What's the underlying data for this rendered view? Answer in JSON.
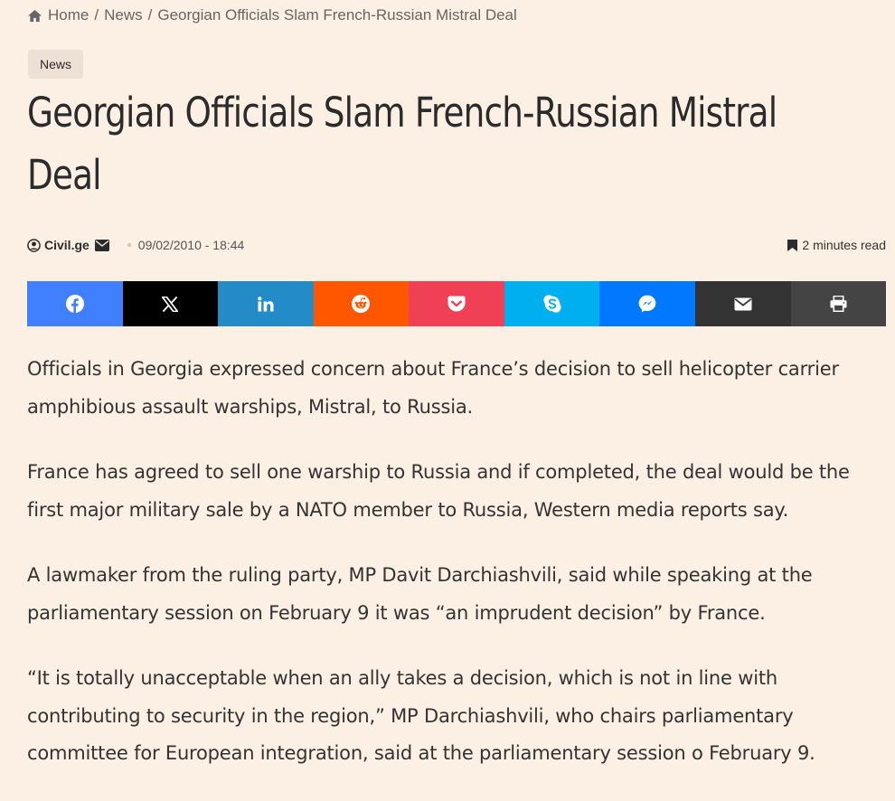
{
  "breadcrumb": {
    "home": "Home",
    "separator": "/",
    "section": "News",
    "current": "Georgian Officials Slam French-Russian Mistral Deal"
  },
  "category_badge": "News",
  "title": "Georgian Officials Slam French-Russian Mistral Deal",
  "meta": {
    "author": "Civil.ge",
    "date": "09/02/2010 - 18:44",
    "read_time": "2 minutes read"
  },
  "share": [
    {
      "network": "facebook",
      "icon": "facebook-icon",
      "color": "#4080ff"
    },
    {
      "network": "x",
      "icon": "x-icon",
      "color": "#000000"
    },
    {
      "network": "linkedin",
      "icon": "linkedin-icon",
      "color": "#238cc8"
    },
    {
      "network": "reddit",
      "icon": "reddit-icon",
      "color": "#ff5700"
    },
    {
      "network": "pocket",
      "icon": "pocket-icon",
      "color": "#ef4056"
    },
    {
      "network": "skype",
      "icon": "skype-icon",
      "color": "#00aff0"
    },
    {
      "network": "messenger",
      "icon": "messenger-icon",
      "color": "#0078ff"
    },
    {
      "network": "email",
      "icon": "envelope-icon",
      "color": "#333333"
    },
    {
      "network": "print",
      "icon": "printer-icon",
      "color": "#444444"
    }
  ],
  "article": {
    "paragraphs": [
      "Officials in Georgia expressed concern about France’s decision to sell helicopter carrier amphibious assault warships, Mistral, to Russia.",
      "France has agreed to sell one warship to Russia and if completed, the deal would be the first major military sale by a NATO member to Russia, Western media reports say.",
      "A lawmaker from the ruling party, MP Davit Darchiashvili, said while speaking at the parliamentary session on February 9 it was “an imprudent decision” by France.",
      "“It is totally unacceptable when an ally takes a decision, which is not in line with contributing to security in the region,” MP Darchiashvili, who chairs parliamentary committee for European integration, said at the parliamentary session o February 9."
    ]
  }
}
